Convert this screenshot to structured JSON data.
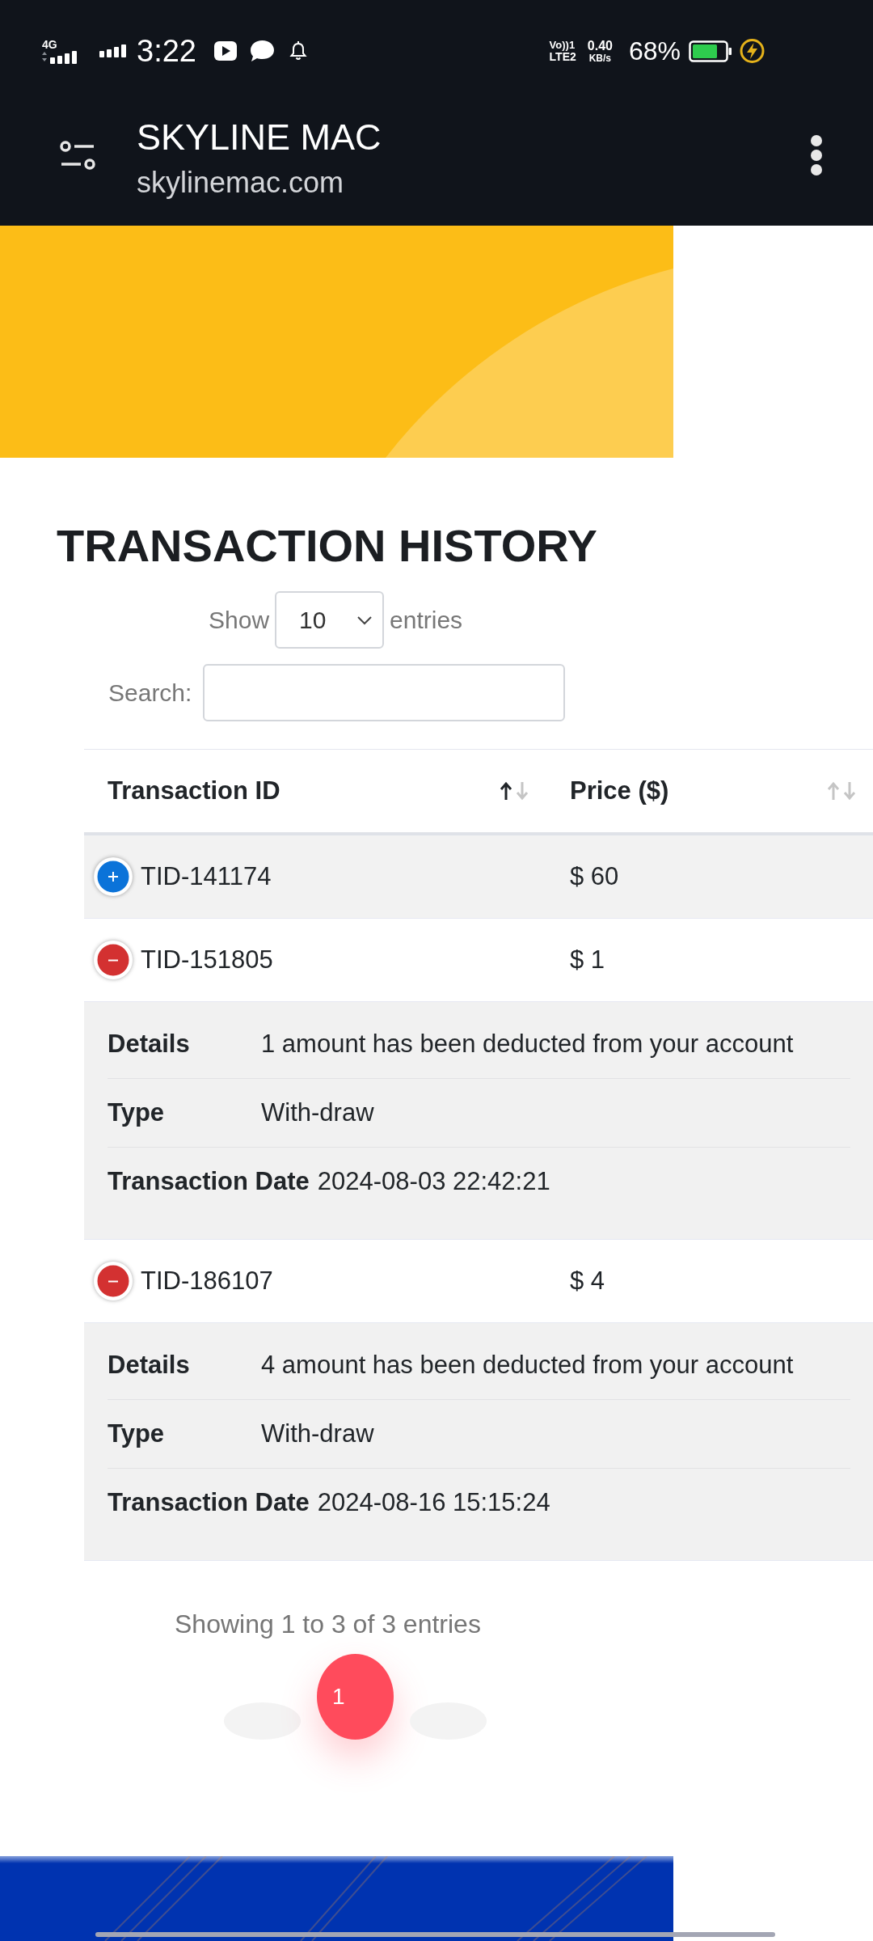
{
  "status_bar": {
    "network_type": "4G",
    "time": "3:22",
    "volte_label": "Vo))1",
    "lte_label": "LTE2",
    "data_speed": "0.40",
    "data_speed_unit": "KB/s",
    "battery_percent": "68%"
  },
  "header": {
    "title": "SKYLINE MAC",
    "url": "skylinemac.com"
  },
  "page_title": "TRANSACTION HISTORY",
  "length_menu": {
    "label": "Show",
    "value": "10",
    "suffix": "entries"
  },
  "search": {
    "label": "Search:"
  },
  "table": {
    "columns": [
      {
        "label": "Transaction ID",
        "sorted": true
      },
      {
        "label": "Price ($)",
        "sorted": false
      }
    ],
    "rows": [
      {
        "transaction_id": "TID-141174",
        "price": "$ 60",
        "expanded": false
      },
      {
        "transaction_id": "TID-151805",
        "price": "$ 1",
        "expanded": true,
        "details": [
          {
            "label": "Details",
            "value": "1 amount has been deducted from your account"
          },
          {
            "label": "Type",
            "value": "With-draw"
          },
          {
            "label": "Transaction Date",
            "value": "2024-08-03 22:42:21"
          }
        ]
      },
      {
        "transaction_id": "TID-186107",
        "price": "$ 4",
        "expanded": true,
        "details": [
          {
            "label": "Details",
            "value": "4 amount has been deducted from your account"
          },
          {
            "label": "Type",
            "value": "With-draw"
          },
          {
            "label": "Transaction Date",
            "value": "2024-08-16 15:15:24"
          }
        ]
      }
    ]
  },
  "info": "Showing 1 to 3 of 3 entries",
  "pagination": {
    "previous": {
      "disabled": true
    },
    "pages": [
      {
        "label": "1",
        "selected": true
      }
    ],
    "next": {
      "disabled": true
    }
  }
}
